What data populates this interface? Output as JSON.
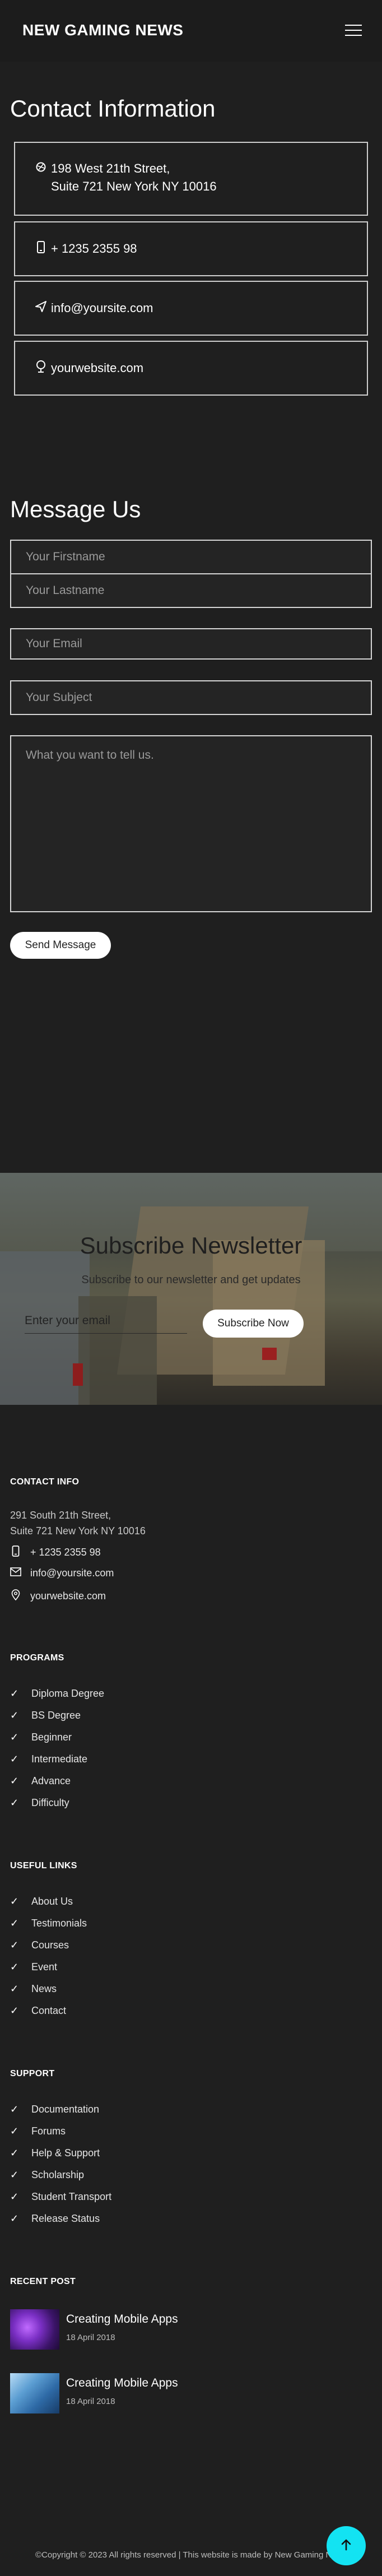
{
  "header": {
    "brand": "NEW GAMING NEWS"
  },
  "contact_info": {
    "title": "Contact Information",
    "address_line1": "198 West 21th Street,",
    "address_line2": "Suite 721 New York NY 10016",
    "phone": "+ 1235 2355 98",
    "email": "info@yoursite.com",
    "website": "yourwebsite.com"
  },
  "message": {
    "title": "Message Us",
    "firstname_placeholder": "Your Firstname",
    "lastname_placeholder": "Your Lastname",
    "email_placeholder": "Your Email",
    "subject_placeholder": "Your Subject",
    "message_placeholder": "What you want to tell us.",
    "send_label": "Send Message"
  },
  "newsletter": {
    "title": "Subscribe Newsletter",
    "subtitle": "Subscribe to our newsletter and get updates",
    "email_placeholder": "Enter your email",
    "button_label": "Subscribe Now"
  },
  "footer": {
    "contact": {
      "heading": "CONTACT INFO",
      "address_line1": "291 South 21th Street,",
      "address_line2": "Suite 721 New York NY 10016",
      "phone": "+ 1235 2355 98",
      "email": "info@yoursite.com",
      "website": "yourwebsite.com"
    },
    "programs": {
      "heading": "PROGRAMS",
      "items": [
        "Diploma Degree",
        "BS Degree",
        "Beginner",
        "Intermediate",
        "Advance",
        "Difficulty"
      ]
    },
    "useful_links": {
      "heading": "USEFUL LINKS",
      "items": [
        "About Us",
        "Testimonials",
        "Courses",
        "Event",
        "News",
        "Contact"
      ]
    },
    "support": {
      "heading": "SUPPORT",
      "items": [
        "Documentation",
        "Forums",
        "Help & Support",
        "Scholarship",
        "Student Transport",
        "Release Status"
      ]
    },
    "recent_post": {
      "heading": "RECENT POST",
      "posts": [
        {
          "title": "Creating Mobile Apps",
          "date": "18 April 2018"
        },
        {
          "title": "Creating Mobile Apps",
          "date": "18 April 2018"
        }
      ]
    },
    "copyright": "©Copyright © 2023 All rights reserved | This website is made by New Gaming News"
  },
  "colors": {
    "background": "#1f1f1f",
    "accent": "#13e3f2"
  },
  "icons": [
    "menu-icon",
    "map-icon",
    "phone-icon",
    "send-icon",
    "globe-icon",
    "mail-icon",
    "location-icon",
    "check-icon",
    "arrow-up-icon"
  ]
}
